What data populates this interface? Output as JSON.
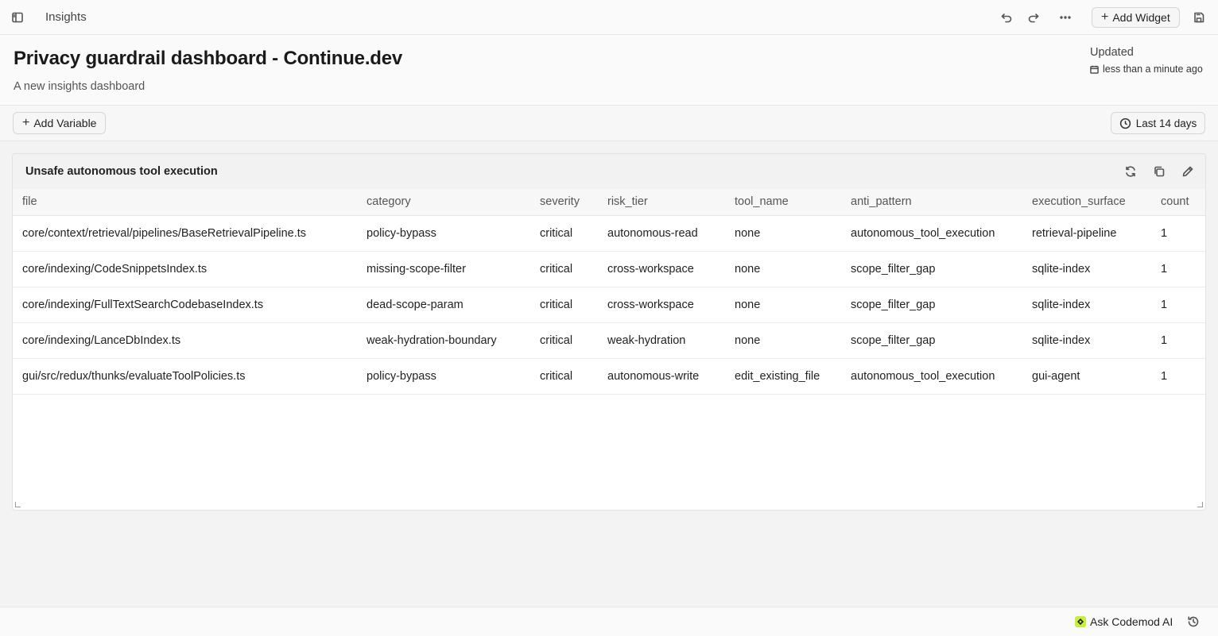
{
  "topbar": {
    "app_title": "Insights",
    "add_widget_label": "Add Widget"
  },
  "header": {
    "title": "Privacy guardrail dashboard - Continue.dev",
    "subtitle": "A new insights dashboard",
    "updated_label": "Updated",
    "updated_time": "less than a minute ago"
  },
  "variables": {
    "add_variable_label": "Add Variable",
    "date_range": "Last 14 days"
  },
  "widget": {
    "title": "Unsafe autonomous tool execution",
    "columns": [
      "file",
      "category",
      "severity",
      "risk_tier",
      "tool_name",
      "anti_pattern",
      "execution_surface",
      "count"
    ],
    "rows": [
      [
        "core/context/retrieval/pipelines/BaseRetrievalPipeline.ts",
        "policy-bypass",
        "critical",
        "autonomous-read",
        "none",
        "autonomous_tool_execution",
        "retrieval-pipeline",
        "1"
      ],
      [
        "core/indexing/CodeSnippetsIndex.ts",
        "missing-scope-filter",
        "critical",
        "cross-workspace",
        "none",
        "scope_filter_gap",
        "sqlite-index",
        "1"
      ],
      [
        "core/indexing/FullTextSearchCodebaseIndex.ts",
        "dead-scope-param",
        "critical",
        "cross-workspace",
        "none",
        "scope_filter_gap",
        "sqlite-index",
        "1"
      ],
      [
        "core/indexing/LanceDbIndex.ts",
        "weak-hydration-boundary",
        "critical",
        "weak-hydration",
        "none",
        "scope_filter_gap",
        "sqlite-index",
        "1"
      ],
      [
        "gui/src/redux/thunks/evaluateToolPolicies.ts",
        "policy-bypass",
        "critical",
        "autonomous-write",
        "edit_existing_file",
        "autonomous_tool_execution",
        "gui-agent",
        "1"
      ]
    ]
  },
  "footer": {
    "ask_ai_label": "Ask Codemod AI"
  },
  "icons": {
    "sidebar_toggle": "sidebar-icon",
    "undo": "undo-icon",
    "redo": "redo-icon",
    "more": "more-horizontal-icon",
    "save": "save-icon",
    "calendar": "calendar-icon",
    "clock": "clock-icon",
    "refresh": "refresh-icon",
    "copy": "copy-icon",
    "edit": "pencil-icon",
    "history": "history-icon",
    "ai": "codemod-logo-icon"
  },
  "colors": {
    "ai_logo": "#c6ef3c"
  }
}
